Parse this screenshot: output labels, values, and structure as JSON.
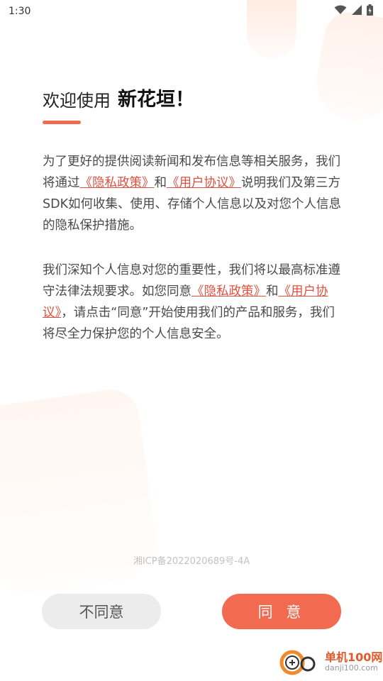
{
  "status_bar": {
    "time": "1:30"
  },
  "header": {
    "title_prefix": "欢迎使用",
    "title_brand": "新花垣！"
  },
  "paragraph1": {
    "text_a": "为了更好的提供阅读新闻和发布信息等相关服务，我们将通过",
    "privacy_link": "《隐私政策》",
    "and": "和",
    "agreement_link": "《用户协议》",
    "text_b": "说明我们及第三方SDK如何收集、使用、存储个人信息以及对您个人信息的隐私保护措施。"
  },
  "paragraph2": {
    "text_a": "我们深知个人信息对您的重要性，我们将以最高标准遵守法律法规要求。如您同意",
    "privacy_link": "《隐私政策》",
    "and": "和",
    "agreement_link": "《用户协议》",
    "text_b": "，请点击“同意”开始使用我们的产品和服务，我们将尽全力保护您的个人信息安全。"
  },
  "footer": {
    "icp": "湘ICP备2022020689号-4A"
  },
  "buttons": {
    "disagree": "不同意",
    "agree": "同 意"
  },
  "watermark": {
    "cn": "单机100网",
    "en": "danji100.com"
  },
  "colors": {
    "accent": "#f26a50",
    "link": "#e05040",
    "disagree_bg": "#ececec"
  }
}
